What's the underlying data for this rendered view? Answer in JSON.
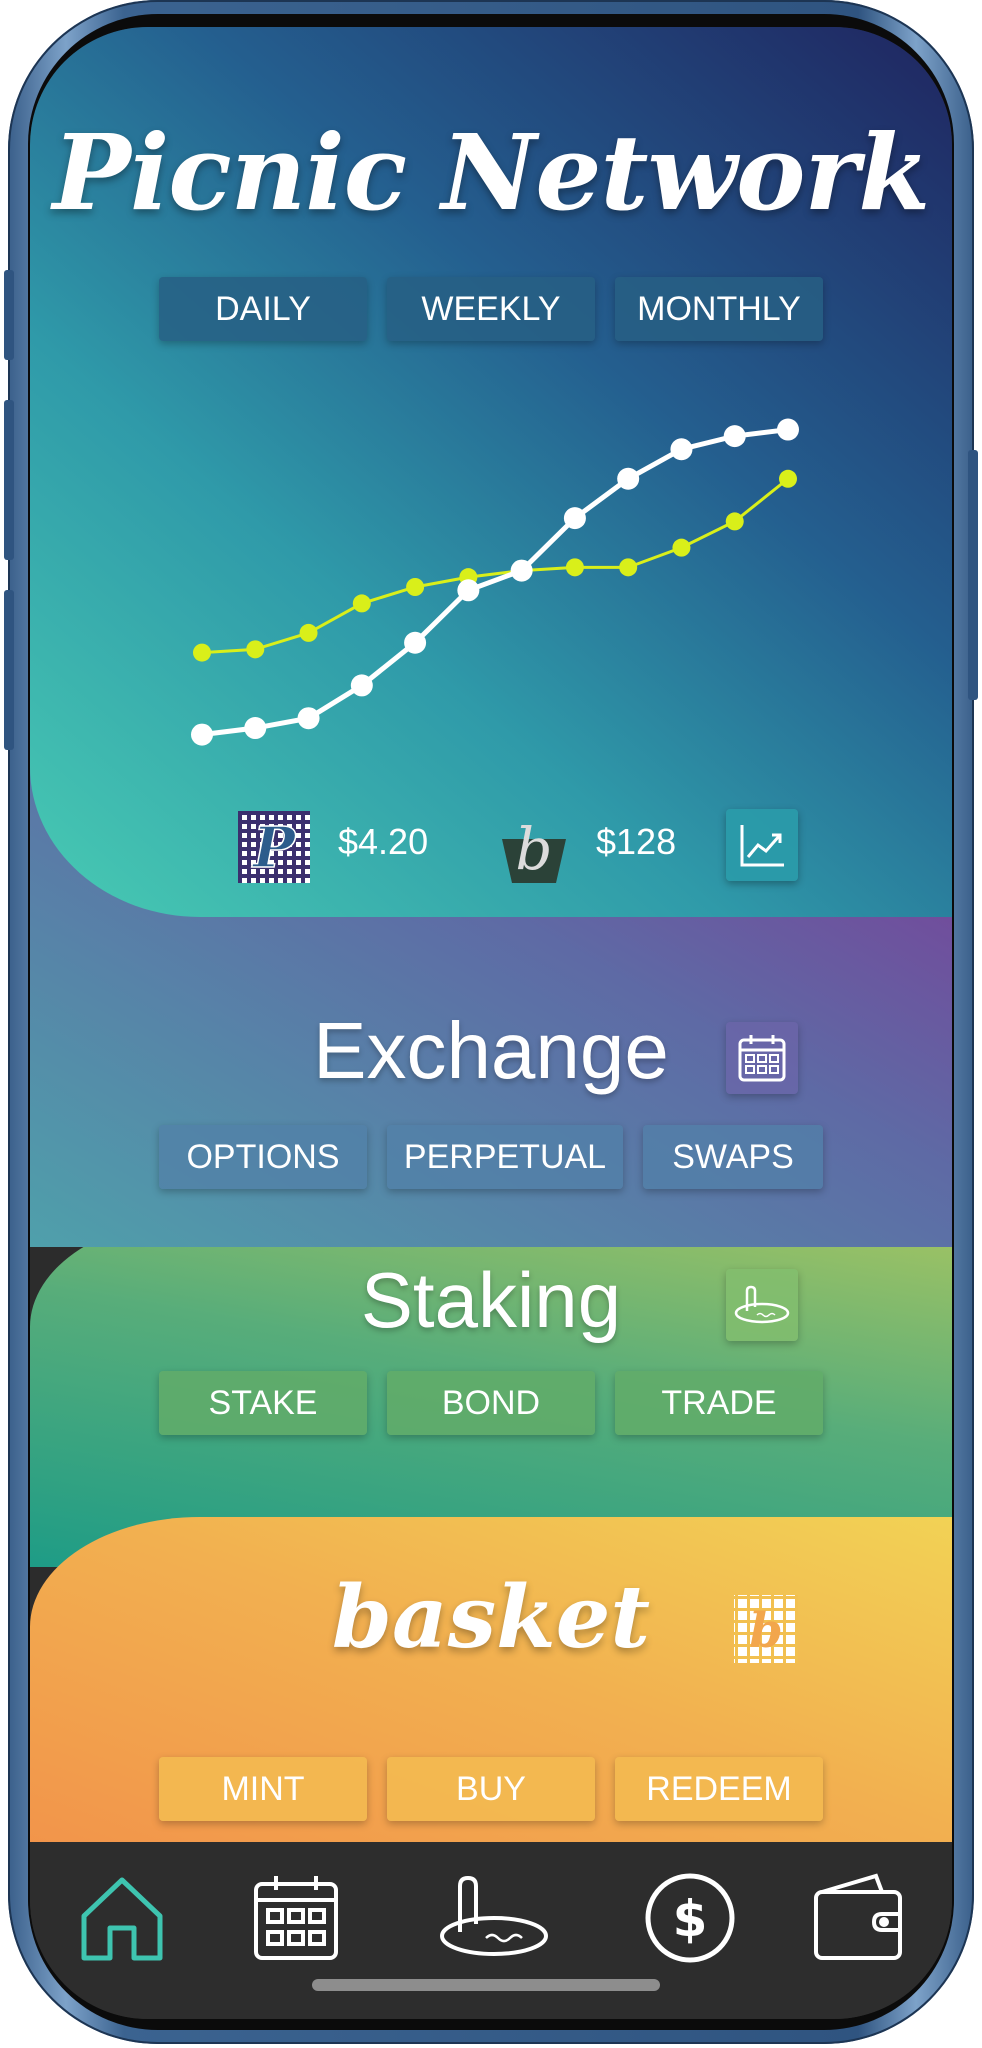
{
  "app": {
    "title": "Picnic Network"
  },
  "hero": {
    "tabs": [
      "DAILY",
      "WEEKLY",
      "MONTHLY"
    ],
    "tokens": [
      {
        "icon": "picnic-p-token-icon",
        "glyph": "P",
        "price": "$4.20"
      },
      {
        "icon": "basket-b-token-icon",
        "glyph": "b",
        "price": "$128"
      }
    ],
    "chart_button_icon": "line-chart-icon"
  },
  "chart_data": {
    "type": "line",
    "x": [
      1,
      2,
      3,
      4,
      5,
      6,
      7,
      8,
      9,
      10,
      11,
      12
    ],
    "ylim": [
      0,
      100
    ],
    "grid": false,
    "series": [
      {
        "color": "#d9ef1a",
        "values": [
          30,
          31,
          36,
          45,
          50,
          53,
          55,
          56,
          56,
          62,
          70,
          83
        ]
      },
      {
        "color": "#ffffff",
        "values": [
          5,
          7,
          10,
          20,
          33,
          49,
          55,
          71,
          83,
          92,
          96,
          98
        ]
      }
    ]
  },
  "exchange": {
    "title": "Exchange",
    "icon": "calendar-icon",
    "tabs": [
      "OPTIONS",
      "PERPETUAL",
      "SWAPS"
    ]
  },
  "staking": {
    "title": "Staking",
    "icon": "picnic-blanket-icon",
    "tabs": [
      "STAKE",
      "BOND",
      "TRADE"
    ]
  },
  "basket": {
    "title": "basket",
    "icon": "basket-weave-icon",
    "icon_glyph": "b",
    "tabs": [
      "MINT",
      "BUY",
      "REDEEM"
    ]
  },
  "nav": {
    "items": [
      {
        "icon": "home-icon",
        "active": true
      },
      {
        "icon": "calendar-icon",
        "active": false
      },
      {
        "icon": "picnic-blanket-icon",
        "active": false
      },
      {
        "icon": "dollar-coin-icon",
        "active": false
      },
      {
        "icon": "wallet-icon",
        "active": false
      }
    ]
  },
  "colors": {
    "accent_teal": "#3ec4b0",
    "series_yellow": "#d9ef1a",
    "series_white": "#ffffff"
  }
}
